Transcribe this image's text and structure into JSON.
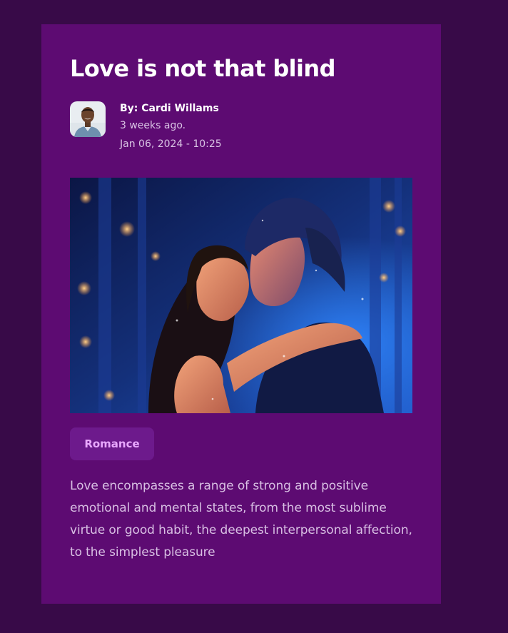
{
  "post": {
    "title": "Love is not that blind",
    "author": "By: Cardi Willams",
    "time_ago": "3 weeks ago.",
    "timestamp": "Jan 06, 2024 - 10:25",
    "category": "Romance",
    "description": "Love encompasses a range of strong and positive emotional and mental states, from the most sublime virtue or good habit, the deepest interpersonal affection, to the simplest pleasure"
  },
  "colors": {
    "page_background": "#380a48",
    "card_background": "#5d0b72",
    "tag_background": "#6d1a8c",
    "tag_text": "#e9a8ff"
  }
}
